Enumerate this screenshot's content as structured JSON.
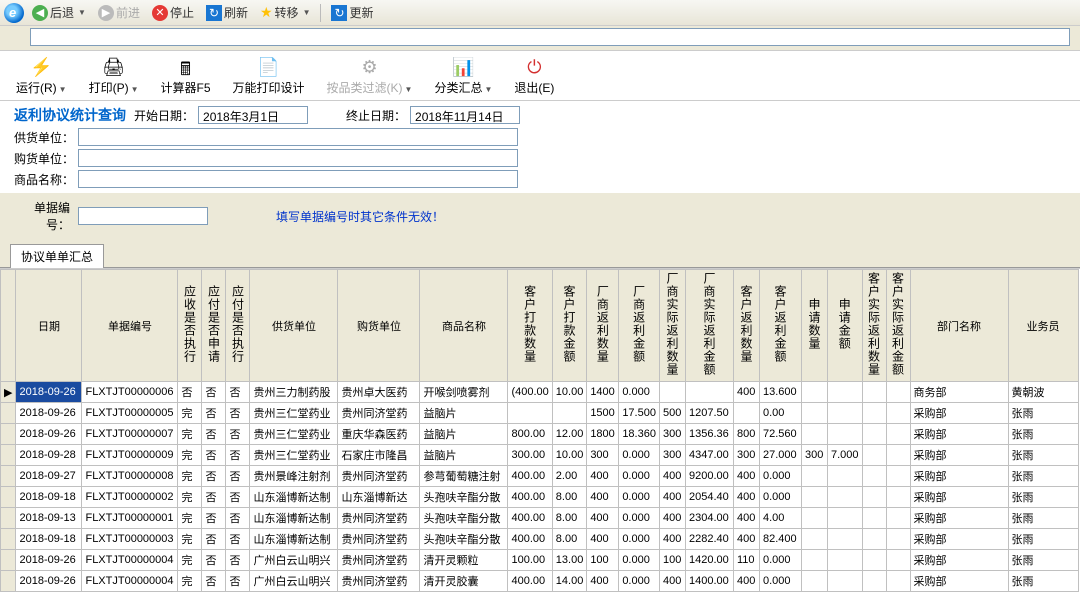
{
  "nav": {
    "back": "后退",
    "forward": "前进",
    "stop": "停止",
    "refresh": "刷新",
    "transfer": "转移",
    "update": "更新"
  },
  "actions": {
    "run": "运行(R)",
    "print": "打印(P)",
    "calc": "计算器F5",
    "design": "万能打印设计",
    "filter": "按品类过滤(K)",
    "summary": "分类汇总",
    "exit": "退出(E)"
  },
  "icons": {
    "run": "⚡",
    "print": "🖨",
    "calc": "🖩",
    "design": "📄",
    "filter": "⚙",
    "summary": "📊",
    "exit": "⏻"
  },
  "query": {
    "title": "返利协议统计查询",
    "start_label": "开始日期：",
    "start_date": "2018年3月1日",
    "end_label": "终止日期：",
    "end_date": "2018年11月14日",
    "supplier_label": "供货单位：",
    "buyer_label": "购货单位：",
    "product_label": "商品名称：",
    "order_label": "单据编号：",
    "hint": "填写单据编号时其它条件无效！"
  },
  "tabs": {
    "main": "协议单单汇总"
  },
  "columns": {
    "date": "日期",
    "billno": "单据编号",
    "c1": "应收是否执行",
    "c2": "应付是否申请",
    "c3": "应付是否执行",
    "supplier": "供货单位",
    "buyer": "购货单位",
    "product": "商品名称",
    "c4": "客户打款数量",
    "c5": "客户打款金额",
    "c6": "厂商返利数量",
    "c7": "厂商返利金额",
    "c8": "厂商实际返利数量",
    "c9": "厂商实际返利金额",
    "c10": "客户返利数量",
    "c11": "客户返利金额",
    "c12": "申请数量",
    "c13": "申请金额",
    "c14": "客户实际返利数量",
    "c15": "客户实际返利金额",
    "dept": "部门名称",
    "sales": "业务员"
  },
  "chart_data": {
    "type": "table",
    "columns": [
      "日期",
      "单据编号",
      "应收是否执行",
      "应付是否申请",
      "应付是否执行",
      "供货单位",
      "购货单位",
      "商品名称",
      "客户打款数量",
      "客户打款金额",
      "厂商返利数量",
      "厂商返利金额",
      "厂商实际返利数量",
      "厂商实际返利金额",
      "客户返利数量",
      "客户返利金额",
      "申请数量",
      "申请金额",
      "客户实际返利数量",
      "客户实际返利金额",
      "部门名称",
      "业务员"
    ],
    "rows": [
      {
        "date": "2018-09-26",
        "billno": "FLXTJT00000006",
        "c1": "否",
        "c2": "否",
        "c3": "否",
        "supplier": "贵州三力制药股",
        "buyer": "贵州卓大医药",
        "product": "开喉剑喷雾剂",
        "q1": "(400.00",
        "a1": "10.00",
        "q2": "1400",
        "a2": "0.000",
        "q3": "",
        "a3": "",
        "q4": "400",
        "a4": "13.600",
        "aq": "",
        "am": "",
        "rq": "",
        "ra": "",
        "dept": "商务部",
        "sales": "黄朝波"
      },
      {
        "date": "2018-09-26",
        "billno": "FLXTJT00000005",
        "c1": "完",
        "c2": "否",
        "c3": "否",
        "supplier": "贵州三仁堂药业",
        "buyer": "贵州同济堂药",
        "product": "益脑片",
        "q1": "",
        "a1": "",
        "q2": "1500",
        "a2": "17.500",
        "q3": "500",
        "a3": "1207.50",
        "q4": "",
        "a4": "0.00",
        "aq": "",
        "am": "",
        "rq": "",
        "ra": "",
        "dept": "采购部",
        "sales": "张雨"
      },
      {
        "date": "2018-09-26",
        "billno": "FLXTJT00000007",
        "c1": "完",
        "c2": "否",
        "c3": "否",
        "supplier": "贵州三仁堂药业",
        "buyer": "重庆华森医药",
        "product": "益脑片",
        "q1": "800.00",
        "a1": "12.00",
        "q2": "1800",
        "a2": "18.360",
        "q3": "300",
        "a3": "1356.36",
        "q4": "800",
        "a4": "72.560",
        "aq": "",
        "am": "",
        "rq": "",
        "ra": "",
        "dept": "采购部",
        "sales": "张雨"
      },
      {
        "date": "2018-09-28",
        "billno": "FLXTJT00000009",
        "c1": "完",
        "c2": "否",
        "c3": "否",
        "supplier": "贵州三仁堂药业",
        "buyer": "石家庄市隆昌",
        "product": "益脑片",
        "q1": "300.00",
        "a1": "10.00",
        "q2": "300",
        "a2": "0.000",
        "q3": "300",
        "a3": "4347.00",
        "q4": "300",
        "a4": "27.000",
        "aq": "300",
        "am": "7.000",
        "rq": "",
        "ra": "",
        "dept": "采购部",
        "sales": "张雨"
      },
      {
        "date": "2018-09-27",
        "billno": "FLXTJT00000008",
        "c1": "完",
        "c2": "否",
        "c3": "否",
        "supplier": "贵州景峰注射剂",
        "buyer": "贵州同济堂药",
        "product": "参芎葡萄糖注射",
        "q1": "400.00",
        "a1": "2.00",
        "q2": "400",
        "a2": "0.000",
        "q3": "400",
        "a3": "9200.00",
        "q4": "400",
        "a4": "0.000",
        "aq": "",
        "am": "",
        "rq": "",
        "ra": "",
        "dept": "采购部",
        "sales": "张雨"
      },
      {
        "date": "2018-09-18",
        "billno": "FLXTJT00000002",
        "c1": "完",
        "c2": "否",
        "c3": "否",
        "supplier": "山东淄博新达制",
        "buyer": "山东淄博新达",
        "product": "头孢呋辛酯分散",
        "q1": "400.00",
        "a1": "8.00",
        "q2": "400",
        "a2": "0.000",
        "q3": "400",
        "a3": "2054.40",
        "q4": "400",
        "a4": "0.000",
        "aq": "",
        "am": "",
        "rq": "",
        "ra": "",
        "dept": "采购部",
        "sales": "张雨"
      },
      {
        "date": "2018-09-13",
        "billno": "FLXTJT00000001",
        "c1": "完",
        "c2": "否",
        "c3": "否",
        "supplier": "山东淄博新达制",
        "buyer": "贵州同济堂药",
        "product": "头孢呋辛酯分散",
        "q1": "400.00",
        "a1": "8.00",
        "q2": "400",
        "a2": "0.000",
        "q3": "400",
        "a3": "2304.00",
        "q4": "400",
        "a4": "4.00",
        "aq": "",
        "am": "",
        "rq": "",
        "ra": "",
        "dept": "采购部",
        "sales": "张雨"
      },
      {
        "date": "2018-09-18",
        "billno": "FLXTJT00000003",
        "c1": "完",
        "c2": "否",
        "c3": "否",
        "supplier": "山东淄博新达制",
        "buyer": "贵州同济堂药",
        "product": "头孢呋辛酯分散",
        "q1": "400.00",
        "a1": "8.00",
        "q2": "400",
        "a2": "0.000",
        "q3": "400",
        "a3": "2282.40",
        "q4": "400",
        "a4": "82.400",
        "aq": "",
        "am": "",
        "rq": "",
        "ra": "",
        "dept": "采购部",
        "sales": "张雨"
      },
      {
        "date": "2018-09-26",
        "billno": "FLXTJT00000004",
        "c1": "完",
        "c2": "否",
        "c3": "否",
        "supplier": "广州白云山明兴",
        "buyer": "贵州同济堂药",
        "product": "清开灵颗粒",
        "q1": "100.00",
        "a1": "13.00",
        "q2": "100",
        "a2": "0.000",
        "q3": "100",
        "a3": "1420.00",
        "q4": "110",
        "a4": "0.000",
        "aq": "",
        "am": "",
        "rq": "",
        "ra": "",
        "dept": "采购部",
        "sales": "张雨"
      },
      {
        "date": "2018-09-26",
        "billno": "FLXTJT00000004",
        "c1": "完",
        "c2": "否",
        "c3": "否",
        "supplier": "广州白云山明兴",
        "buyer": "贵州同济堂药",
        "product": "清开灵胶囊",
        "q1": "400.00",
        "a1": "14.00",
        "q2": "400",
        "a2": "0.000",
        "q3": "400",
        "a3": "1400.00",
        "q4": "400",
        "a4": "0.000",
        "aq": "",
        "am": "",
        "rq": "",
        "ra": "",
        "dept": "采购部",
        "sales": "张雨"
      }
    ]
  }
}
